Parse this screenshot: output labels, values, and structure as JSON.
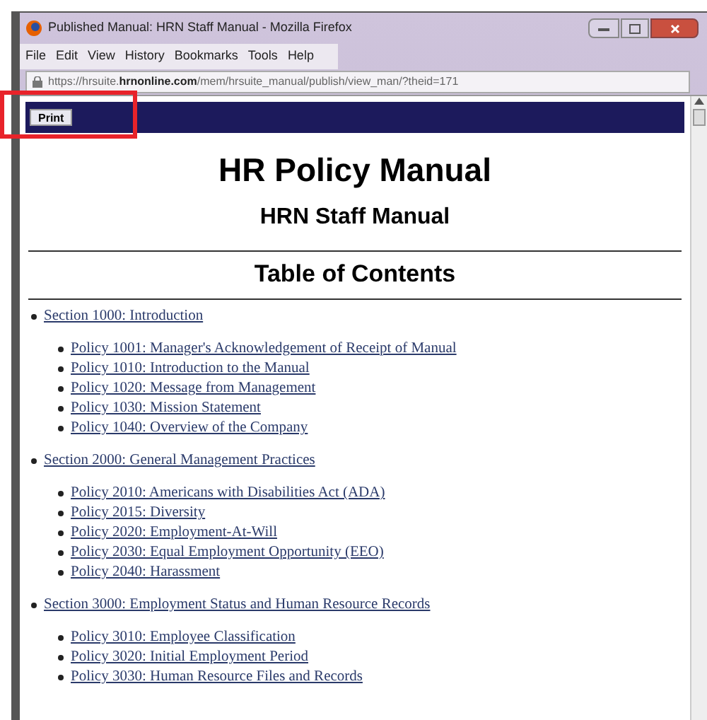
{
  "window": {
    "title": "Published Manual: HRN Staff Manual - Mozilla Firefox"
  },
  "menu": [
    "File",
    "Edit",
    "View",
    "History",
    "Bookmarks",
    "Tools",
    "Help"
  ],
  "address_bar": {
    "url": "https://hrsuite.**hrnonline.com**/mem/hrsuite_manual/publish/view_man/?theid=171"
  },
  "toolbar": {
    "print_button": "Print"
  },
  "page": {
    "title": "HR Policy Manual",
    "subtitle": "HRN Staff Manual",
    "toc_heading": "Table of Contents"
  },
  "sections": [
    {
      "label": "Section 1000: Introduction",
      "children": [
        {
          "label": "Policy 1001: Manager's Acknowledgement of Receipt of Manual"
        },
        {
          "label": "Policy 1010: Introduction to the Manual"
        },
        {
          "label": "Policy 1020: Message from Management"
        },
        {
          "label": "Policy 1030: Mission Statement"
        },
        {
          "label": "Policy 1040: Overview of the Company"
        }
      ]
    },
    {
      "label": "Section 2000: General Management Practices",
      "children": [
        {
          "label": "Policy 2010: Americans with Disabilities Act (ADA)"
        },
        {
          "label": "Policy 2015: Diversity"
        },
        {
          "label": "Policy 2020: Employment-At-Will"
        },
        {
          "label": "Policy 2030: Equal Employment Opportunity (EEO)"
        },
        {
          "label": "Policy 2040: Harassment"
        }
      ]
    },
    {
      "label": "Section 3000: Employment Status and Human Resource Records",
      "children": [
        {
          "label": "Policy 3010: Employee Classification"
        },
        {
          "label": "Policy 3020: Initial Employment Period"
        },
        {
          "label": "Policy 3030: Human Resource Files and Records"
        }
      ]
    }
  ]
}
